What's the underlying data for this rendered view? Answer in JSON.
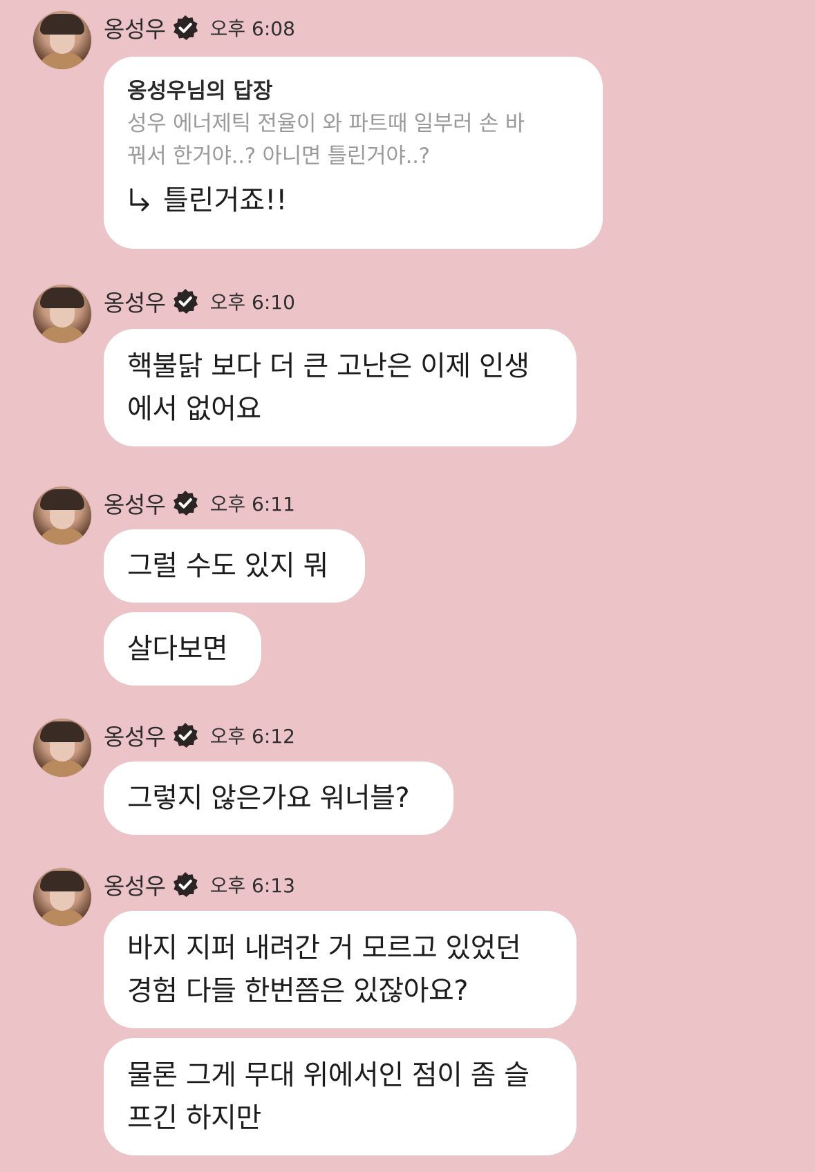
{
  "messages": [
    {
      "sender": "옹성우",
      "time": "오후 6:08",
      "reply": {
        "title": "옹성우님의 답장",
        "quote_line1": "성우 에너제틱 전율이 와 파트때 일부러 손 바",
        "quote_line2": "꿔서 한거야..? 아니면 틀린거야..?",
        "answer": "틀린거죠!!"
      }
    },
    {
      "sender": "옹성우",
      "time": "오후 6:10",
      "bubbles": [
        {
          "line1": "핵불닭 보다 더 큰 고난은 이제 인생",
          "line2": "에서 없어요"
        }
      ]
    },
    {
      "sender": "옹성우",
      "time": "오후 6:11",
      "bubbles": [
        {
          "line1": "그럴 수도 있지 뭐"
        },
        {
          "line1": "살다보면"
        }
      ]
    },
    {
      "sender": "옹성우",
      "time": "오후 6:12",
      "bubbles": [
        {
          "line1": "그렇지 않은가요 워너블?"
        }
      ]
    },
    {
      "sender": "옹성우",
      "time": "오후 6:13",
      "bubbles": [
        {
          "line1": "바지 지퍼 내려간 거 모르고 있었던",
          "line2": "경험 다들 한번쯤은 있잖아요?"
        },
        {
          "line1": "물론 그게 무대 위에서인 점이 좀 슬",
          "line2": "프긴 하지만"
        }
      ]
    }
  ],
  "icons": {
    "verified": "verified-badge-icon",
    "reply_arrow": "reply-arrow-icon",
    "avatar": "profile-avatar"
  },
  "colors": {
    "background": "#ecc3c7",
    "bubble": "#ffffff",
    "verified_badge": "#2b2424",
    "quote_text": "#9a9a9a"
  }
}
